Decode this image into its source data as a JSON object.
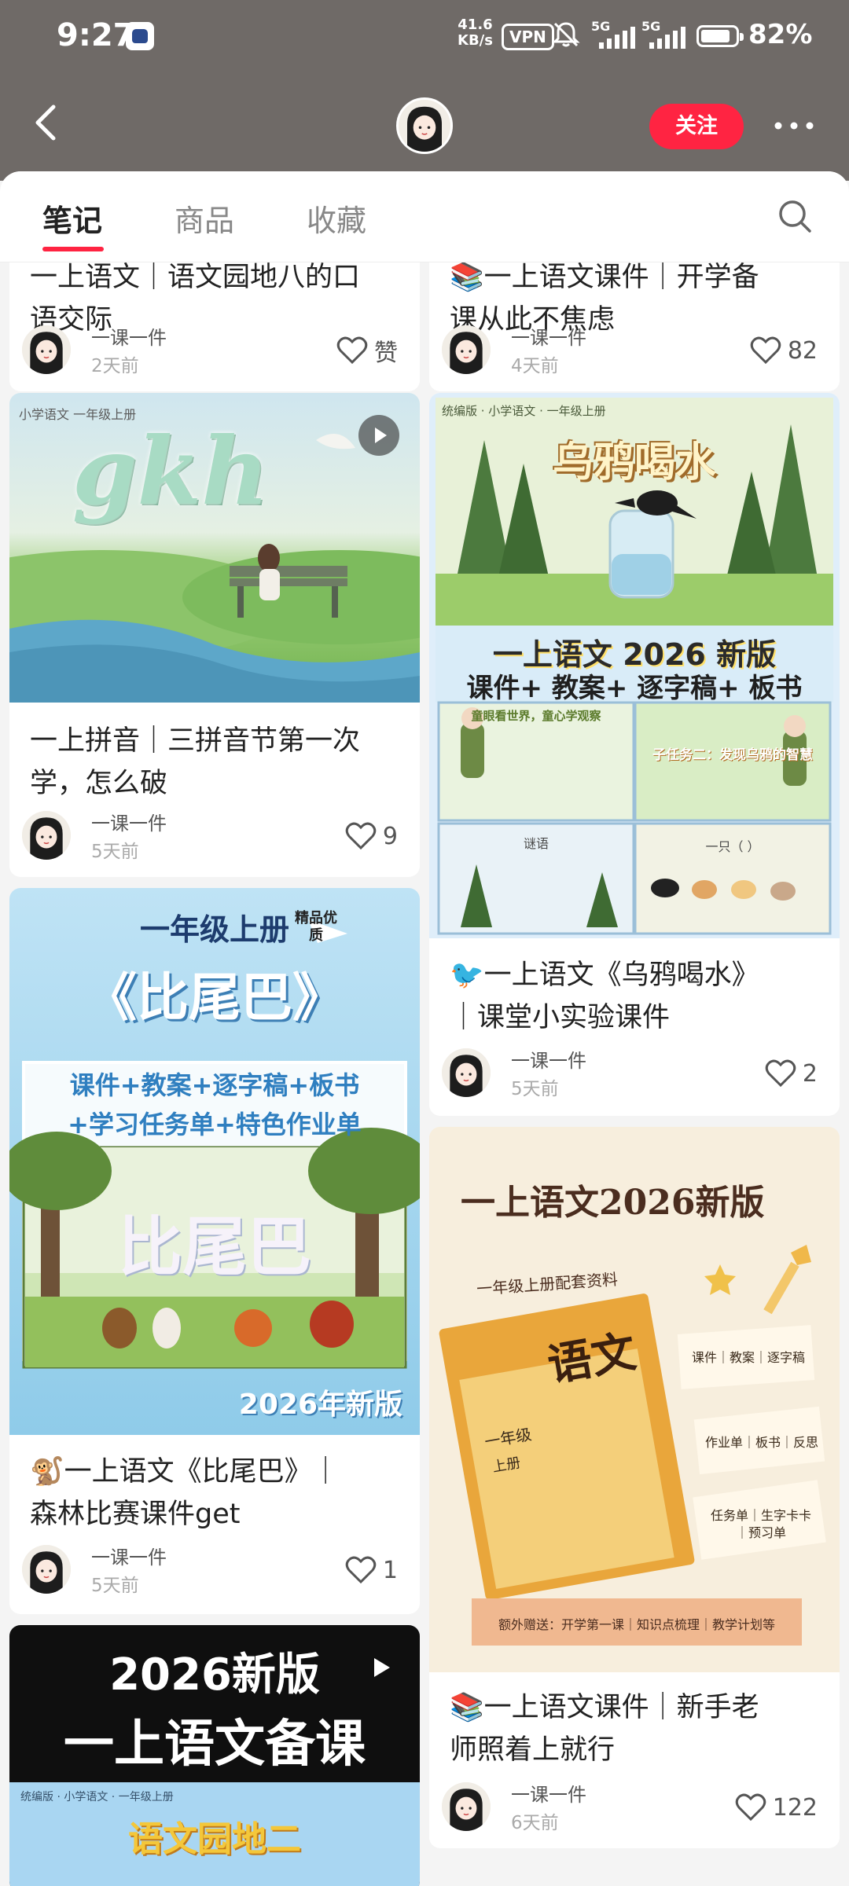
{
  "status": {
    "time": "9:27",
    "speed_top": "41.6",
    "speed_unit": "KB/s",
    "vpn": "VPN",
    "net1": "5G",
    "net2": "5G",
    "battery": "82%"
  },
  "header": {
    "follow_label": "关注",
    "more_label": "···",
    "back_label": "‹"
  },
  "tabs": [
    {
      "label": "笔记",
      "active": true
    },
    {
      "label": "商品",
      "active": false
    },
    {
      "label": "收藏",
      "active": false
    }
  ],
  "colors": {
    "accent": "#ff2442",
    "header_bg": "#6f6a67"
  },
  "cards": [
    {
      "title_line1": "一上语文｜语文园地八的口",
      "title_line2": "语交际",
      "author": "一课一件",
      "date": "2天前",
      "likes": "赞"
    },
    {
      "title_line1": "📚一上语文课件｜开学备",
      "title_line2": "课从此不焦虑",
      "author": "一课一件",
      "date": "4天前",
      "likes": "82"
    },
    {
      "cover_header": "小学语文 一年级上册",
      "cover_big": "gkh",
      "title_line1": "一上拼音｜三拼音节第一次",
      "title_line2": "学，怎么破",
      "author": "一课一件",
      "date": "5天前",
      "likes": "9"
    },
    {
      "cover_header": "统编版 · 小学语文 · 一年级上册",
      "cover_big": "乌鸦喝水",
      "cover_band1": "一上语文 2026 新版",
      "cover_band2": "课件+ 教案+ 逐字稿+ 板书",
      "cover_panel1": "童眼看世界，童心学观察",
      "cover_panel2": "子任务二：发现乌鸦的智慧",
      "cover_panel3": "谜语",
      "cover_panel4": "一只（ ）",
      "title_line1": "🐦一上语文《乌鸦喝水》",
      "title_line2": "｜课堂小实验课件",
      "author": "一课一件",
      "date": "5天前",
      "likes": "2"
    },
    {
      "cover_top": "一年级上册",
      "cover_badge": "精品优质",
      "cover_big": "《比尾巴》",
      "cover_line1": "课件+教案+逐字稿+板书",
      "cover_line2": "+学习任务单+特色作业单",
      "cover_scene": "比尾巴",
      "cover_year": "2026年新版",
      "title_line1": "🐒一上语文《比尾巴》｜",
      "title_line2": "森林比赛课件get",
      "author": "一课一件",
      "date": "5天前",
      "likes": "1"
    },
    {
      "cover_title": "一上语文2026新版",
      "cover_ribbon": "一年级上册配套资料",
      "cover_book_title": "语文",
      "cover_book_grade": "一年级",
      "cover_book_term": "上册",
      "cover_note1": "课件｜教案｜逐字稿",
      "cover_note2": "作业单｜板书｜反思",
      "cover_note3": "任务单｜生字卡卡｜预习单",
      "cover_bottom": "额外赠送：开学第一课｜知识点梳理｜教学计划等",
      "title_line1": "📚一上语文课件｜新手老",
      "title_line2": "师照着上就行",
      "author": "一课一件",
      "date": "6天前",
      "likes": "122"
    },
    {
      "cover_line1": "2026新版",
      "cover_line2": "一上语文备课",
      "cover_header": "统编版 · 小学语文 · 一年级上册",
      "cover_big": "语文园地二"
    }
  ]
}
